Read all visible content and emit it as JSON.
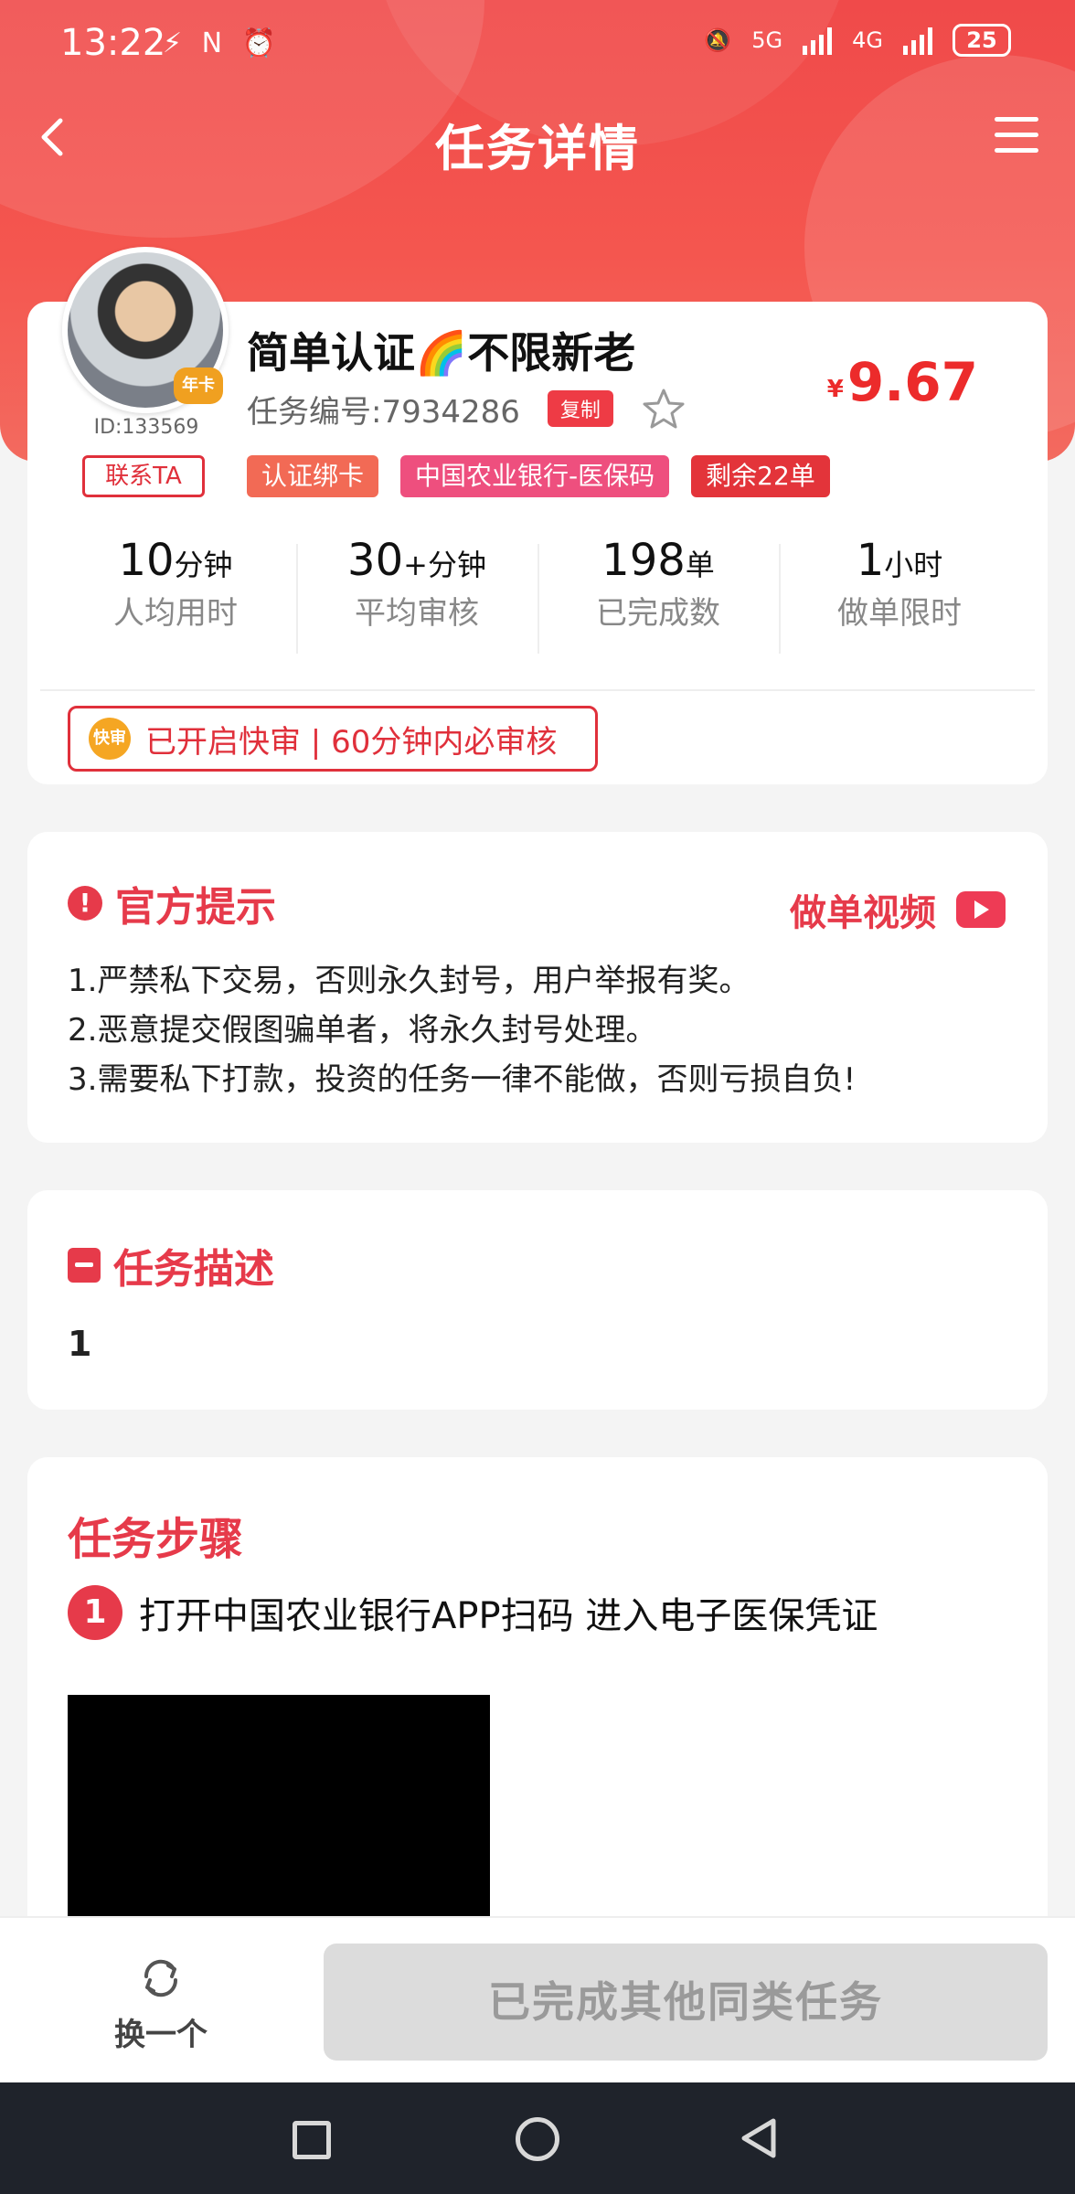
{
  "status_bar": {
    "time": "13:22",
    "left_icons": "⚡ N ⏰",
    "network_left": "5G",
    "network_right": "4G",
    "battery": "25"
  },
  "navbar": {
    "title": "任务详情"
  },
  "task": {
    "title": "简单认证🌈不限新老",
    "task_number": "任务编号:7934286",
    "copy_label": "复制",
    "price_symbol": "¥",
    "price": "9.67",
    "user_id": "ID:133569",
    "avatar_badge": "年卡",
    "contact_label": "联系TA",
    "tags": [
      "认证绑卡",
      "中国农业银行-医保码",
      "剩余22单"
    ],
    "stats": [
      {
        "value": "10",
        "unit": "分钟",
        "label": "人均用时"
      },
      {
        "value": "30",
        "unit": "+分钟",
        "label": "平均审核"
      },
      {
        "value": "198",
        "unit": "单",
        "label": "已完成数"
      },
      {
        "value": "1",
        "unit": "小时",
        "label": "做单限时"
      }
    ],
    "quick_review": {
      "icon_text": "快审",
      "text": "已开启快审 | 60分钟内必审核"
    }
  },
  "notice": {
    "title": "官方提示",
    "video_label": "做单视频",
    "lines": [
      "1.严禁私下交易，否则永久封号，用户举报有奖。",
      "2.恶意提交假图骗单者，将永久封号处理。",
      "3.需要私下打款，投资的任务一律不能做，否则亏损自负!"
    ]
  },
  "description": {
    "title": "任务描述",
    "text": "1"
  },
  "steps": {
    "title": "任务步骤",
    "items": [
      {
        "num": "1",
        "text": "打开中国农业银行APP扫码  进入电子医保凭证"
      }
    ]
  },
  "bottom": {
    "swap_label": "换一个",
    "done_label": "已完成其他同类任务"
  },
  "colors": {
    "primary": "#e63a4a",
    "header": "#f04a4a",
    "price": "#ec2b2b"
  }
}
